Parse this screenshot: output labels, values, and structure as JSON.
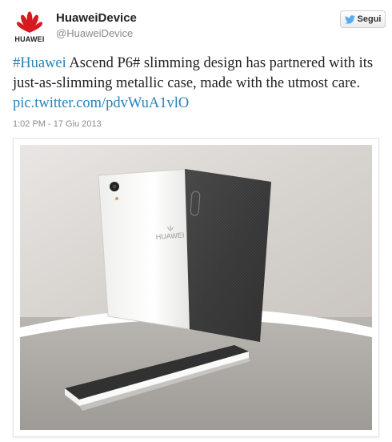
{
  "account": {
    "display_name": "HuaweiDevice",
    "handle": "@HuaweiDevice",
    "logo_text": "HUAWEI"
  },
  "follow_button": {
    "label": "Segui",
    "icon": "twitter-bird-icon"
  },
  "tweet": {
    "hashtag_1": "#Huawei",
    "text_1": " Ascend P6# slimming design has partnered with its just-as-slimming metallic case, made with the utmost care. ",
    "link": "pic.twitter.com/pdvWuA1vlO",
    "timestamp": "1:02 PM - 17 Giu 2013"
  },
  "photo": {
    "phone_brand": "HUAWEI"
  },
  "colors": {
    "link": "#2a82b8",
    "twitter_blue": "#55acee",
    "huawei_red": "#d71920"
  }
}
